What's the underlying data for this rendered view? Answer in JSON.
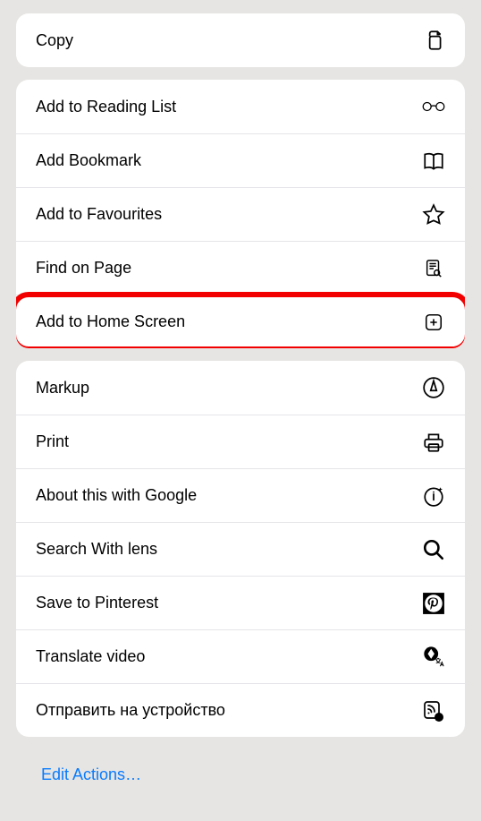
{
  "groups": [
    {
      "rows": [
        {
          "name": "copy",
          "label": "Copy",
          "icon": "copy-icon"
        }
      ]
    },
    {
      "rows": [
        {
          "name": "add-to-reading-list",
          "label": "Add to Reading List",
          "icon": "glasses-icon"
        },
        {
          "name": "add-bookmark",
          "label": "Add Bookmark",
          "icon": "book-icon"
        },
        {
          "name": "add-to-favourites",
          "label": "Add to Favourites",
          "icon": "star-icon"
        },
        {
          "name": "find-on-page",
          "label": "Find on Page",
          "icon": "doc-search-icon"
        },
        {
          "name": "add-to-home-screen",
          "label": "Add to Home Screen",
          "icon": "plus-square-icon",
          "highlight": true
        }
      ]
    },
    {
      "rows": [
        {
          "name": "markup",
          "label": "Markup",
          "icon": "markup-icon"
        },
        {
          "name": "print",
          "label": "Print",
          "icon": "printer-icon"
        },
        {
          "name": "about-google",
          "label": "About this with Google",
          "icon": "info-sparkle-icon"
        },
        {
          "name": "search-lens",
          "label": "Search With lens",
          "icon": "magnify-icon"
        },
        {
          "name": "save-pinterest",
          "label": "Save to Pinterest",
          "icon": "pinterest-icon"
        },
        {
          "name": "translate-video",
          "label": "Translate video",
          "icon": "translate-video-icon"
        },
        {
          "name": "send-to-device",
          "label": "Отправить на устройство",
          "icon": "cast-device-icon"
        }
      ]
    }
  ],
  "footer": {
    "edit_actions": "Edit Actions…"
  }
}
